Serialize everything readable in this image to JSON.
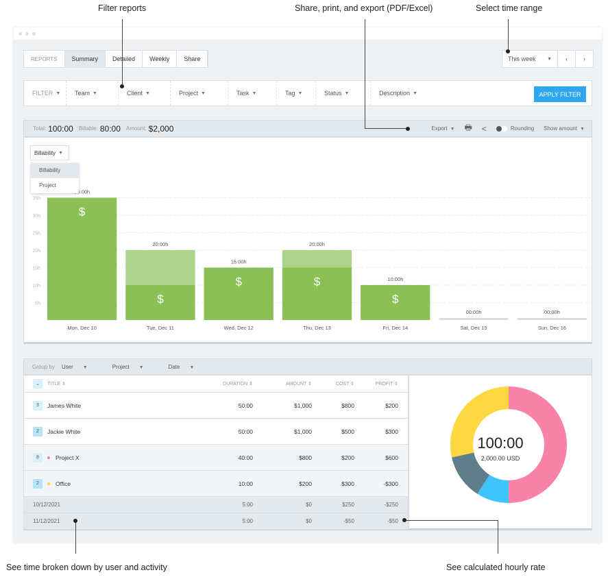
{
  "annotations": {
    "filter": "Filter reports",
    "export": "Share, print, and export (PDF/Excel)",
    "range": "Select time range",
    "breakdown": "See time broken down by user and activity",
    "rate": "See calculated hourly rate"
  },
  "tabs": {
    "label": "REPORTS",
    "items": [
      "Summary",
      "Detailed",
      "Weekly",
      "Share"
    ],
    "active": "Summary"
  },
  "range": {
    "selected": "This week",
    "prev": "‹",
    "next": "›"
  },
  "filter": {
    "label": "FILTER",
    "items": [
      "Team",
      "Client",
      "Project",
      "Task",
      "Tag",
      "Status",
      "Description"
    ],
    "apply": "APPLY FILTER"
  },
  "summary": {
    "total_label": "Total:",
    "total": "100:00",
    "billable_label": "Billable:",
    "billable": "80:00",
    "amount_label": "Amount:",
    "amount": "$2,000",
    "export": "Export",
    "rounding": "Rounding",
    "show_amount": "Show amount"
  },
  "chart_controls": {
    "selected": "Billability",
    "options": [
      "Billability",
      "Project"
    ]
  },
  "colors": {
    "billable": "#8bc057",
    "nonbillable": "#acd48a",
    "accent": "#2ea6f0"
  },
  "chart_data": {
    "type": "bar",
    "stacked": true,
    "categories": [
      "Mon, Dec 10",
      "Tue, Dec 11",
      "Wed, Dec 12",
      "Thu, Dec 13",
      "Fri, Dec 14",
      "Sat, Dec 15",
      "Sun, Dec 16"
    ],
    "series": [
      {
        "values": [
          35,
          10,
          15,
          15,
          10,
          0,
          0
        ]
      },
      {
        "values": [
          0,
          10,
          0,
          5,
          0,
          0,
          0
        ]
      }
    ],
    "bar_labels": [
      "35:00h",
      "20:00h",
      "15:00h",
      "20:00h",
      "10:00h",
      "00:00h",
      "00:00h"
    ],
    "yticks": [
      "5h",
      "10h",
      "15h",
      "20h",
      "25h",
      "30h",
      "35h"
    ],
    "ylim": [
      0,
      40
    ],
    "billable_icon": "$",
    "grid": true
  },
  "groupby": {
    "label": "Group by",
    "items": [
      "User",
      "Project",
      "Date"
    ]
  },
  "table": {
    "headers": [
      "TITLE",
      "DURATION",
      "AMOUNT",
      "COST",
      "PROFIT"
    ],
    "rows": [
      {
        "count": "3",
        "title": "James White",
        "duration": "50:00",
        "amount": "$1,000",
        "cost": "$800",
        "profit": "$200",
        "type": "user"
      },
      {
        "count": "2",
        "title": "Jackie White",
        "duration": "50:00",
        "amount": "$1,000",
        "cost": "$500",
        "profit": "$300",
        "type": "user"
      },
      {
        "count": "8",
        "title": "Project X",
        "duration": "40:00",
        "amount": "$800",
        "cost": "$200",
        "profit": "$600",
        "type": "project",
        "color": "#f27fa6"
      },
      {
        "count": "2",
        "title": "Office",
        "duration": "10:00",
        "amount": "$200",
        "cost": "$300",
        "profit": "-$300",
        "type": "project",
        "color": "#fdd442"
      },
      {
        "title": "10/12/2021",
        "duration": "5:00",
        "amount": "$0",
        "cost": "$250",
        "profit": "-$250",
        "type": "date"
      },
      {
        "title": "11/12/2021",
        "duration": "5:00",
        "amount": "$0",
        "cost": "-$50",
        "profit": "-$50",
        "type": "date"
      }
    ]
  },
  "donut": {
    "total": "100:00",
    "amount": "2,000.00 USD",
    "slices": [
      {
        "value": 50,
        "color": "#f982a9"
      },
      {
        "value": 9,
        "color": "#40c4ff"
      },
      {
        "value": 12.5,
        "color": "#607d8b"
      },
      {
        "value": 28.5,
        "color": "#fdd843"
      }
    ]
  }
}
